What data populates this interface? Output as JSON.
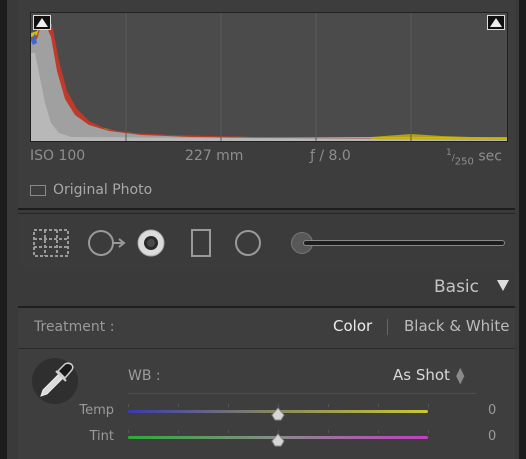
{
  "histogram": {
    "iso": "ISO 100",
    "focal_length": "227 mm",
    "aperture": "ƒ / 8.0",
    "shutter_numerator": "1",
    "shutter_denominator": "250",
    "shutter_unit": " sec",
    "original_photo_label": "Original Photo",
    "original_photo_checked": false
  },
  "tools": [
    {
      "name": "crop-overlay-tool"
    },
    {
      "name": "spot-removal-tool"
    },
    {
      "name": "red-eye-tool"
    },
    {
      "name": "graduated-filter-tool"
    },
    {
      "name": "radial-filter-tool"
    },
    {
      "name": "adjustment-brush-tool"
    }
  ],
  "basic": {
    "title": "Basic",
    "treatment_label": "Treatment :",
    "treatment_options": [
      "Color",
      "Black & White"
    ],
    "treatment_selected": "Color",
    "wb_label": "WB :",
    "wb_value": "As Shot",
    "sliders": [
      {
        "label": "Temp",
        "value": "0",
        "position": 0.5
      },
      {
        "label": "Tint",
        "value": "0",
        "position": 0.5
      }
    ]
  },
  "colors": {
    "temp_gradient": [
      "#3a3ab0",
      "#8a8a60",
      "#c8c830"
    ],
    "tint_gradient": [
      "#2faa3a",
      "#8a8a8a",
      "#c040c0"
    ]
  }
}
